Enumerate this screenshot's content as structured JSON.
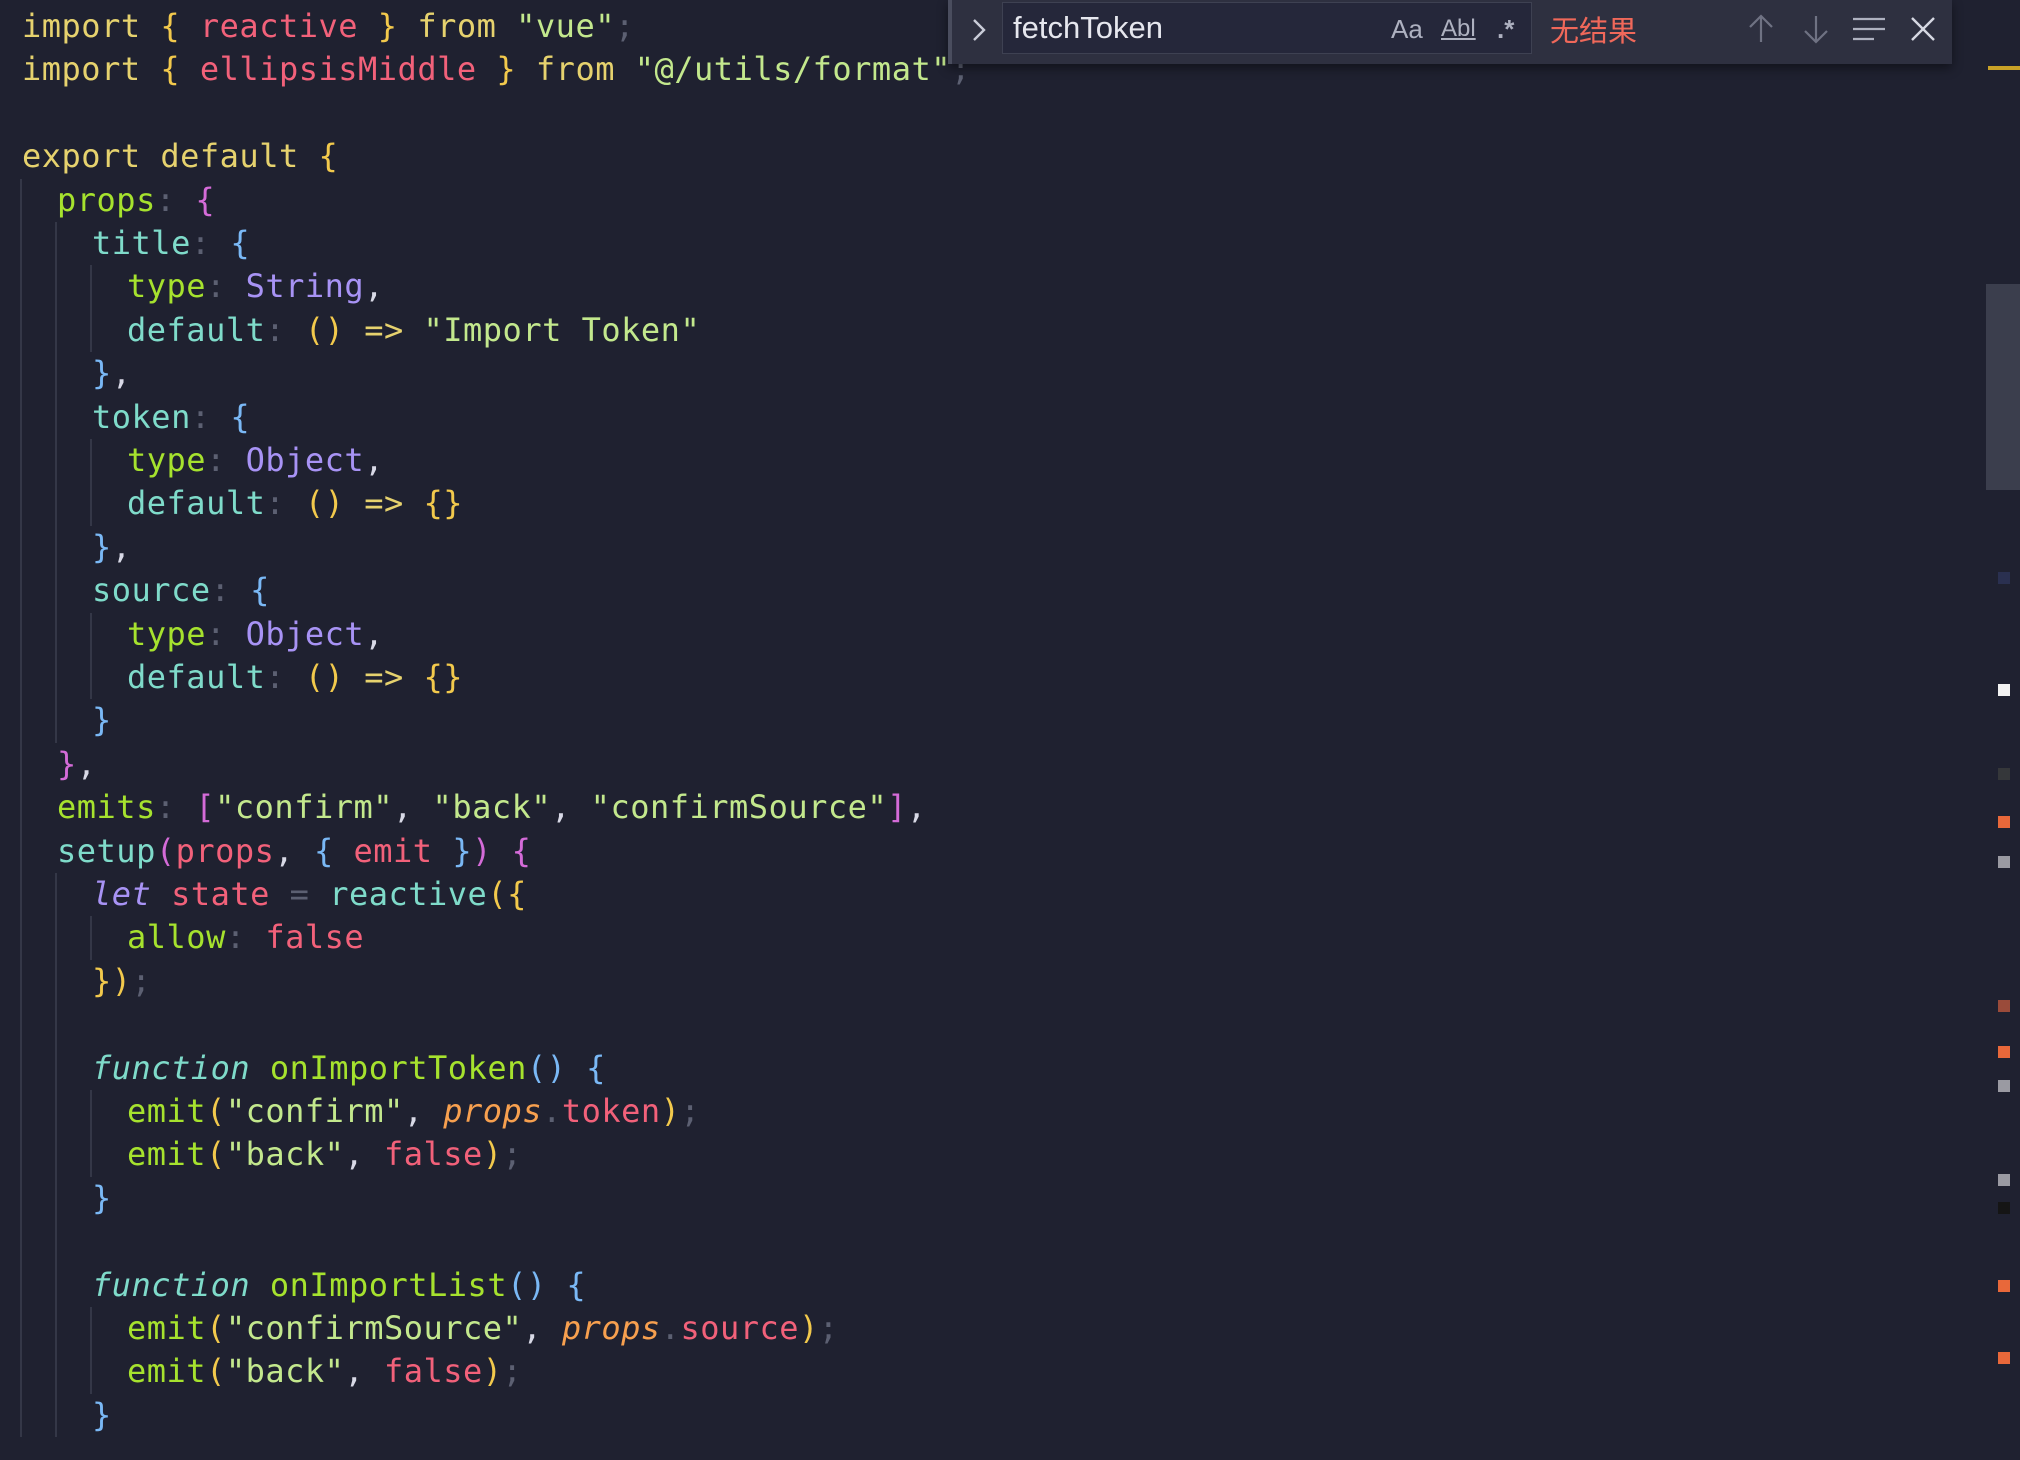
{
  "code_lines": [
    {
      "indent": 0,
      "tokens": [
        {
          "text": "import",
          "color": "#e6d26e"
        },
        {
          "text": " ",
          "color": "#d8d9e6"
        },
        {
          "text": "{",
          "color": "#f2c94c"
        },
        {
          "text": " reactive ",
          "color": "#f2617a"
        },
        {
          "text": "}",
          "color": "#f2c94c"
        },
        {
          "text": " from ",
          "color": "#e6d26e"
        },
        {
          "text": "\"vue\"",
          "color": "#c3e88d"
        },
        {
          "text": ";",
          "color": "#5c6072"
        }
      ]
    },
    {
      "indent": 0,
      "tokens": [
        {
          "text": "import",
          "color": "#e6d26e"
        },
        {
          "text": " ",
          "color": "#d8d9e6"
        },
        {
          "text": "{",
          "color": "#f2c94c"
        },
        {
          "text": " ellipsisMiddle ",
          "color": "#f2617a"
        },
        {
          "text": "}",
          "color": "#f2c94c"
        },
        {
          "text": " from ",
          "color": "#e6d26e"
        },
        {
          "text": "\"@/utils/format\"",
          "color": "#c3e88d"
        },
        {
          "text": ";",
          "color": "#5c6072"
        }
      ]
    },
    {
      "indent": 0,
      "tokens": []
    },
    {
      "indent": 0,
      "tokens": [
        {
          "text": "export default ",
          "color": "#e6d26e"
        },
        {
          "text": "{",
          "color": "#f2c94c"
        }
      ]
    },
    {
      "indent": 1,
      "tokens": [
        {
          "text": "props",
          "color": "#a6e22e"
        },
        {
          "text": ": ",
          "color": "#5c6072"
        },
        {
          "text": "{",
          "color": "#d46bd8"
        }
      ]
    },
    {
      "indent": 2,
      "tokens": [
        {
          "text": "title",
          "color": "#7fdbca"
        },
        {
          "text": ": ",
          "color": "#5c6072"
        },
        {
          "text": "{",
          "color": "#7ab8f5"
        }
      ]
    },
    {
      "indent": 3,
      "tokens": [
        {
          "text": "type",
          "color": "#a6e22e"
        },
        {
          "text": ": ",
          "color": "#5c6072"
        },
        {
          "text": "String",
          "color": "#a893f5"
        },
        {
          "text": ",",
          "color": "#d8d9e6"
        }
      ]
    },
    {
      "indent": 3,
      "tokens": [
        {
          "text": "default",
          "color": "#7fdbca"
        },
        {
          "text": ": ",
          "color": "#5c6072"
        },
        {
          "text": "()",
          "color": "#f2c94c"
        },
        {
          "text": " => ",
          "color": "#e6d26e"
        },
        {
          "text": "\"Import Token\"",
          "color": "#c3e88d"
        }
      ]
    },
    {
      "indent": 2,
      "tokens": [
        {
          "text": "}",
          "color": "#7ab8f5"
        },
        {
          "text": ",",
          "color": "#d8d9e6"
        }
      ]
    },
    {
      "indent": 2,
      "tokens": [
        {
          "text": "token",
          "color": "#7fdbca"
        },
        {
          "text": ": ",
          "color": "#5c6072"
        },
        {
          "text": "{",
          "color": "#7ab8f5"
        }
      ]
    },
    {
      "indent": 3,
      "tokens": [
        {
          "text": "type",
          "color": "#a6e22e"
        },
        {
          "text": ": ",
          "color": "#5c6072"
        },
        {
          "text": "Object",
          "color": "#a893f5"
        },
        {
          "text": ",",
          "color": "#d8d9e6"
        }
      ]
    },
    {
      "indent": 3,
      "tokens": [
        {
          "text": "default",
          "color": "#7fdbca"
        },
        {
          "text": ": ",
          "color": "#5c6072"
        },
        {
          "text": "()",
          "color": "#f2c94c"
        },
        {
          "text": " => ",
          "color": "#e6d26e"
        },
        {
          "text": "{}",
          "color": "#f2c94c"
        }
      ]
    },
    {
      "indent": 2,
      "tokens": [
        {
          "text": "}",
          "color": "#7ab8f5"
        },
        {
          "text": ",",
          "color": "#d8d9e6"
        }
      ]
    },
    {
      "indent": 2,
      "tokens": [
        {
          "text": "source",
          "color": "#7fdbca"
        },
        {
          "text": ": ",
          "color": "#5c6072"
        },
        {
          "text": "{",
          "color": "#7ab8f5"
        }
      ]
    },
    {
      "indent": 3,
      "tokens": [
        {
          "text": "type",
          "color": "#a6e22e"
        },
        {
          "text": ": ",
          "color": "#5c6072"
        },
        {
          "text": "Object",
          "color": "#a893f5"
        },
        {
          "text": ",",
          "color": "#d8d9e6"
        }
      ]
    },
    {
      "indent": 3,
      "tokens": [
        {
          "text": "default",
          "color": "#7fdbca"
        },
        {
          "text": ": ",
          "color": "#5c6072"
        },
        {
          "text": "()",
          "color": "#f2c94c"
        },
        {
          "text": " => ",
          "color": "#e6d26e"
        },
        {
          "text": "{}",
          "color": "#f2c94c"
        }
      ]
    },
    {
      "indent": 2,
      "tokens": [
        {
          "text": "}",
          "color": "#7ab8f5"
        }
      ]
    },
    {
      "indent": 1,
      "tokens": [
        {
          "text": "}",
          "color": "#d46bd8"
        },
        {
          "text": ",",
          "color": "#d8d9e6"
        }
      ]
    },
    {
      "indent": 1,
      "tokens": [
        {
          "text": "emits",
          "color": "#a6e22e"
        },
        {
          "text": ": ",
          "color": "#5c6072"
        },
        {
          "text": "[",
          "color": "#d46bd8"
        },
        {
          "text": "\"confirm\"",
          "color": "#c3e88d"
        },
        {
          "text": ", ",
          "color": "#d8d9e6"
        },
        {
          "text": "\"back\"",
          "color": "#c3e88d"
        },
        {
          "text": ", ",
          "color": "#d8d9e6"
        },
        {
          "text": "\"confirmSource\"",
          "color": "#c3e88d"
        },
        {
          "text": "]",
          "color": "#d46bd8"
        },
        {
          "text": ",",
          "color": "#d8d9e6"
        }
      ]
    },
    {
      "indent": 1,
      "tokens": [
        {
          "text": "setup",
          "color": "#7fdbca"
        },
        {
          "text": "(",
          "color": "#d46bd8"
        },
        {
          "text": "props",
          "color": "#f2617a"
        },
        {
          "text": ", ",
          "color": "#d8d9e6"
        },
        {
          "text": "{",
          "color": "#7ab8f5"
        },
        {
          "text": " emit ",
          "color": "#f2617a"
        },
        {
          "text": "}",
          "color": "#7ab8f5"
        },
        {
          "text": ")",
          "color": "#d46bd8"
        },
        {
          "text": " ",
          "color": "#d8d9e6"
        },
        {
          "text": "{",
          "color": "#d46bd8"
        }
      ]
    },
    {
      "indent": 2,
      "tokens": [
        {
          "text": "let",
          "color": "#a893f5",
          "italic": true
        },
        {
          "text": " state ",
          "color": "#f2617a"
        },
        {
          "text": "=",
          "color": "#5c6072"
        },
        {
          "text": " reactive",
          "color": "#7fdbca"
        },
        {
          "text": "({",
          "color": "#f2c94c"
        }
      ]
    },
    {
      "indent": 3,
      "tokens": [
        {
          "text": "allow",
          "color": "#a6e22e"
        },
        {
          "text": ": ",
          "color": "#5c6072"
        },
        {
          "text": "false",
          "color": "#f2617a"
        }
      ]
    },
    {
      "indent": 2,
      "tokens": [
        {
          "text": "})",
          "color": "#f2c94c"
        },
        {
          "text": ";",
          "color": "#5c6072"
        }
      ]
    },
    {
      "indent": 2,
      "tokens": []
    },
    {
      "indent": 2,
      "tokens": [
        {
          "text": "function",
          "color": "#7fdbca",
          "italic": true
        },
        {
          "text": " onImportToken",
          "color": "#a6e22e"
        },
        {
          "text": "()",
          "color": "#7ab8f5"
        },
        {
          "text": " {",
          "color": "#7ab8f5"
        }
      ]
    },
    {
      "indent": 3,
      "tokens": [
        {
          "text": "emit",
          "color": "#a6e22e"
        },
        {
          "text": "(",
          "color": "#f2c94c"
        },
        {
          "text": "\"confirm\"",
          "color": "#c3e88d"
        },
        {
          "text": ", ",
          "color": "#d8d9e6"
        },
        {
          "text": "props",
          "color": "#f7a04f",
          "italic": true
        },
        {
          "text": ".",
          "color": "#5c6072"
        },
        {
          "text": "token",
          "color": "#f2617a"
        },
        {
          "text": ")",
          "color": "#f2c94c"
        },
        {
          "text": ";",
          "color": "#5c6072"
        }
      ]
    },
    {
      "indent": 3,
      "tokens": [
        {
          "text": "emit",
          "color": "#a6e22e"
        },
        {
          "text": "(",
          "color": "#f2c94c"
        },
        {
          "text": "\"back\"",
          "color": "#c3e88d"
        },
        {
          "text": ", ",
          "color": "#d8d9e6"
        },
        {
          "text": "false",
          "color": "#f2617a"
        },
        {
          "text": ")",
          "color": "#f2c94c"
        },
        {
          "text": ";",
          "color": "#5c6072"
        }
      ]
    },
    {
      "indent": 2,
      "tokens": [
        {
          "text": "}",
          "color": "#7ab8f5"
        }
      ]
    },
    {
      "indent": 2,
      "tokens": []
    },
    {
      "indent": 2,
      "tokens": [
        {
          "text": "function",
          "color": "#7fdbca",
          "italic": true
        },
        {
          "text": " onImportList",
          "color": "#a6e22e"
        },
        {
          "text": "()",
          "color": "#7ab8f5"
        },
        {
          "text": " {",
          "color": "#7ab8f5"
        }
      ]
    },
    {
      "indent": 3,
      "tokens": [
        {
          "text": "emit",
          "color": "#a6e22e"
        },
        {
          "text": "(",
          "color": "#f2c94c"
        },
        {
          "text": "\"confirmSource\"",
          "color": "#c3e88d"
        },
        {
          "text": ", ",
          "color": "#d8d9e6"
        },
        {
          "text": "props",
          "color": "#f7a04f",
          "italic": true
        },
        {
          "text": ".",
          "color": "#5c6072"
        },
        {
          "text": "source",
          "color": "#f2617a"
        },
        {
          "text": ")",
          "color": "#f2c94c"
        },
        {
          "text": ";",
          "color": "#5c6072"
        }
      ]
    },
    {
      "indent": 3,
      "tokens": [
        {
          "text": "emit",
          "color": "#a6e22e"
        },
        {
          "text": "(",
          "color": "#f2c94c"
        },
        {
          "text": "\"back\"",
          "color": "#c3e88d"
        },
        {
          "text": ", ",
          "color": "#d8d9e6"
        },
        {
          "text": "false",
          "color": "#f2617a"
        },
        {
          "text": ")",
          "color": "#f2c94c"
        },
        {
          "text": ";",
          "color": "#5c6072"
        }
      ]
    },
    {
      "indent": 2,
      "tokens": [
        {
          "text": "}",
          "color": "#7ab8f5"
        }
      ]
    }
  ],
  "find_widget": {
    "toggle_icon": "chevron-right-icon",
    "search_value": "fetchToken",
    "match_case_label": "Aa",
    "whole_word_label": "Abl",
    "regex_label": ".*",
    "status_text": "无结果",
    "status_color": "#f0685a",
    "previous_icon": "arrow-up-icon",
    "next_icon": "arrow-down-icon",
    "selection_icon": "find-in-selection-icon",
    "close_icon": "close-icon"
  },
  "scrollbar_marks": [
    {
      "color": "#2a3050"
    },
    {
      "color": "#f2f2f2"
    },
    {
      "color": "#35373a"
    },
    {
      "color": "#e8683a"
    },
    {
      "color": "#9a9aa2"
    },
    {
      "color": "#9a4b3a"
    },
    {
      "color": "#e8683a"
    },
    {
      "color": "#9a9aa2"
    },
    {
      "color": "#9a9aa2"
    },
    {
      "color": "#151515"
    },
    {
      "color": "#e8683a"
    },
    {
      "color": "#e8683a"
    }
  ],
  "theme": {
    "background": "#1f2130",
    "find_widget_background": "#2e3040",
    "scrollbar_thumb": "#3b3e4d",
    "indent_guide": "#343747"
  }
}
